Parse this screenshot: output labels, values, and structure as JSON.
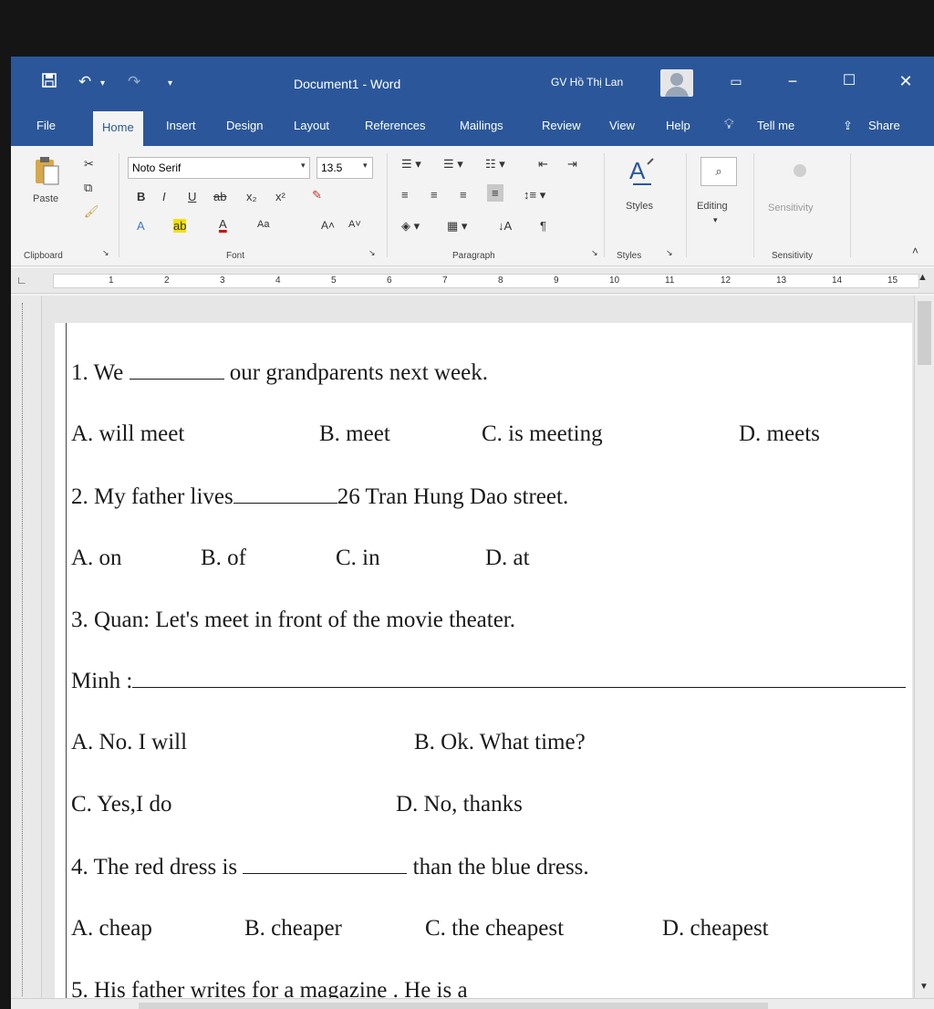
{
  "window": {
    "title": "Document1 - Word",
    "user": "GV Hồ Thị Lan"
  },
  "tabs": [
    "File",
    "Home",
    "Insert",
    "Design",
    "Layout",
    "References",
    "Mailings",
    "Review",
    "View",
    "Help",
    "Tell me",
    "Share"
  ],
  "ribbon": {
    "paste_label": "Paste",
    "clipboard_label": "Clipboard",
    "font_name": "Noto Serif",
    "font_size": "13.5",
    "font_label": "Font",
    "paragraph_label": "Paragraph",
    "styles_button": "Styles",
    "styles_label": "Styles",
    "editing_button": "Editing",
    "sensitivity_button": "Sensitivity",
    "sensitivity_label": "Sensitivity",
    "font_buttons": [
      "B",
      "I",
      "U",
      "x₂",
      "x²",
      "A",
      "Aa"
    ],
    "paragraph_mark": "¶"
  },
  "ruler_numbers": [
    "1",
    "2",
    "3",
    "4",
    "5",
    "6",
    "7",
    "8",
    "9",
    "10",
    "11",
    "12",
    "13",
    "14",
    "15"
  ],
  "document": {
    "lines": [
      {
        "id": "q1",
        "text_before": "1. We",
        "text_after": "our grandparents next week."
      },
      {
        "id": "q1-opts",
        "options": [
          "A. will meet",
          "B. meet",
          "C. is meeting",
          "D. meets"
        ]
      },
      {
        "id": "q2",
        "text_before": "2. My father lives",
        "text_after": "26 Tran Hung Dao street."
      },
      {
        "id": "q2-opts",
        "options": [
          "A. on",
          "B. of",
          "C. in",
          "D. at"
        ]
      },
      {
        "id": "q3",
        "text": "3. Quan: Let's meet in front of the movie theater."
      },
      {
        "id": "q3-minh",
        "text_before": "Minh :"
      },
      {
        "id": "q3-opts1",
        "options": [
          "A. No. I will",
          "B. Ok. What time?"
        ]
      },
      {
        "id": "q3-opts2",
        "options": [
          "C. Yes,I do",
          "D. No, thanks"
        ]
      },
      {
        "id": "q4",
        "text_before": "4. The red dress is",
        "text_after": "than the blue dress."
      },
      {
        "id": "q4-opts",
        "options": [
          "A. cheap",
          "B. cheaper",
          "C. the cheapest",
          "D. cheapest"
        ]
      },
      {
        "id": "q5",
        "text": "5. His father writes for a magazine . He is a"
      }
    ]
  },
  "icons": [
    "save-icon",
    "undo-icon",
    "redo-icon",
    "minimize-icon",
    "maximize-icon",
    "close-icon",
    "lightbulb-icon",
    "share-icon",
    "search-icon",
    "styles-icon"
  ]
}
